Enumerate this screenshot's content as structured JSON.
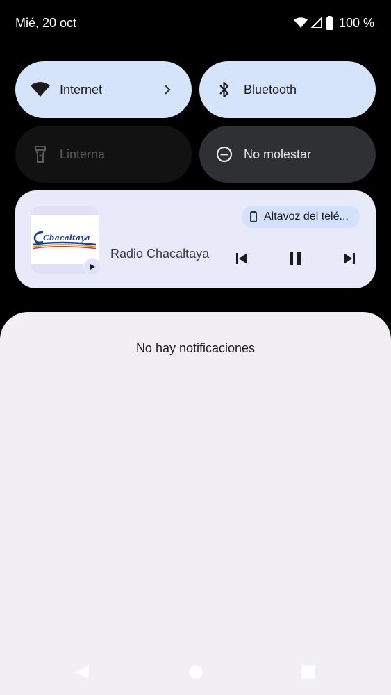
{
  "status_bar": {
    "date": "Mié, 20 oct",
    "battery": "100 %"
  },
  "tiles": {
    "internet": {
      "label": "Internet",
      "icon": "wifi-icon"
    },
    "bluetooth": {
      "label": "Bluetooth",
      "icon": "bluetooth-icon"
    },
    "flashlight": {
      "label": "Linterna",
      "icon": "flashlight-icon"
    },
    "dnd": {
      "label": "No molestar",
      "icon": "do-not-disturb-icon"
    }
  },
  "media": {
    "title": "Radio Chacaltaya",
    "output": "Altavoz del telé...",
    "album_logo_text": "Chacaltaya",
    "controls": [
      "previous-icon",
      "pause-icon",
      "next-icon"
    ]
  },
  "notifications": {
    "empty_text": "No hay notificaciones"
  },
  "nav": {
    "buttons": [
      "back-icon",
      "home-icon",
      "recents-icon"
    ]
  },
  "colors": {
    "tile_active": "#d6e4fb",
    "tile_inactive": "#2f3033",
    "media_card": "#e8e9f9",
    "shade": "#f1eff4"
  }
}
